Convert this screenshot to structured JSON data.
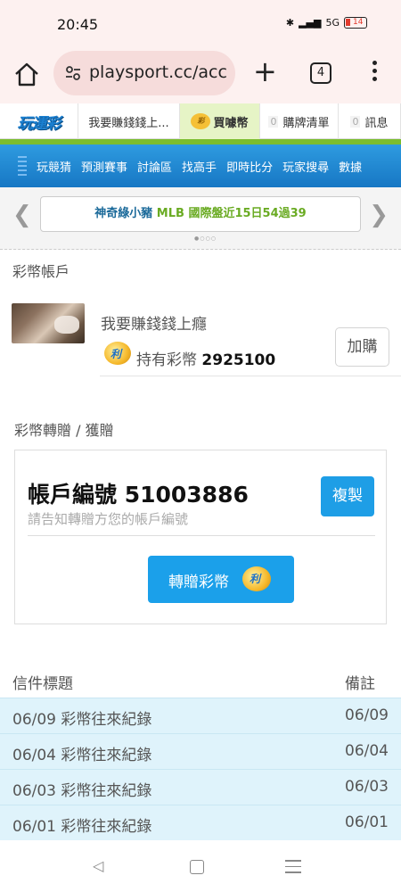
{
  "status": {
    "time": "20:45",
    "network": "5G",
    "battery_level": "14"
  },
  "browser": {
    "url": "playsport.cc/acco",
    "tab_count": "4"
  },
  "site_tabs": {
    "logo": "玩運彩",
    "username_tab": "我要賺錢錢上...",
    "buy_coins": "買噱幣",
    "cart_count": "0",
    "cart_label": "購牌清單",
    "msg_count": "0",
    "msg_label": "訊息"
  },
  "nav": {
    "items": [
      "玩競猜",
      "預測賽事",
      "討論區",
      "找高手",
      "即時比分",
      "玩家搜尋",
      "數據"
    ]
  },
  "banner": {
    "part1": "神奇綠小豬",
    "part2": "MLB 國際盤近15日54過39"
  },
  "wallet": {
    "section_title": "彩幣帳戶",
    "username": "我要賺錢錢上癮",
    "holding_label": "持有彩幣",
    "holding_value": "2925100",
    "add_button": "加購"
  },
  "transfer": {
    "section_title": "彩幣轉贈 / 獲贈",
    "account_label": "帳戶編號 51003886",
    "hint": "請告知轉贈方您的帳戶編號",
    "copy_button": "複製",
    "gift_button": "轉贈彩幣"
  },
  "mail": {
    "col_title": "信件標題",
    "col_note": "備註",
    "rows": [
      {
        "title": "06/09 彩幣往來紀錄",
        "note": "06/09"
      },
      {
        "title": "06/04 彩幣往來紀錄",
        "note": "06/04"
      },
      {
        "title": "06/03 彩幣往來紀錄",
        "note": "06/03"
      },
      {
        "title": "06/01 彩幣往來紀錄",
        "note": "06/01"
      }
    ]
  },
  "colors": {
    "accent_blue": "#1ba0ea",
    "row_highlight": "#dff3fb",
    "brand_green": "#7bbd2e"
  }
}
